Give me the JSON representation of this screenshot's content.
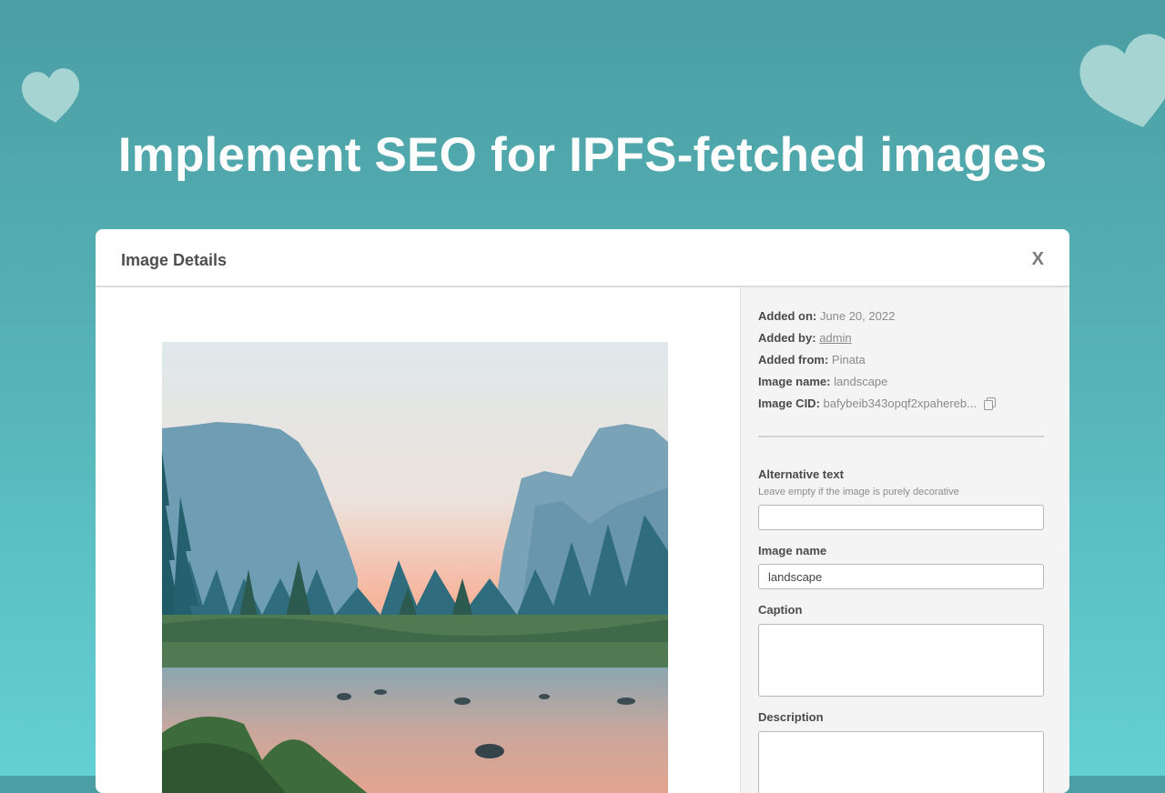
{
  "headline": "Implement SEO for IPFS-fetched images",
  "modal": {
    "title": "Image Details",
    "close_label": "X"
  },
  "meta": {
    "added_on_label": "Added on:",
    "added_on_value": "June 20, 2022",
    "added_by_label": "Added by:",
    "added_by_value": "admin",
    "added_from_label": "Added from:",
    "added_from_value": "Pinata",
    "image_name_label": "Image name:",
    "image_name_value": "landscape",
    "image_cid_label": "Image CID:",
    "image_cid_value": "bafybeib343opqf2xpahereb..."
  },
  "form": {
    "alt_label": "Alternative text",
    "alt_hint": "Leave empty if the image is purely decorative",
    "alt_value": "",
    "name_label": "Image name",
    "name_value": "landscape",
    "caption_label": "Caption",
    "caption_value": "",
    "description_label": "Description",
    "description_value": ""
  },
  "icons": {
    "copy": "copy-icon",
    "close": "close-icon",
    "decor": "heart-icon"
  },
  "colors": {
    "background_top": "#4b9ea3",
    "background_bottom": "#63d0d4",
    "heart": "#a6d4d3",
    "panel": "#f4f4f4"
  }
}
